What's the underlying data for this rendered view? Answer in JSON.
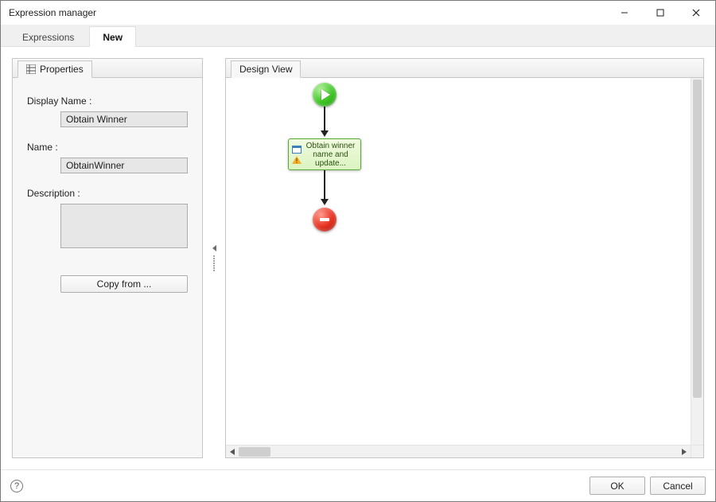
{
  "window": {
    "title": "Expression manager"
  },
  "tabs": {
    "expressions": "Expressions",
    "new": "New"
  },
  "properties": {
    "tab_label": "Properties",
    "display_name_label": "Display Name :",
    "display_name_value": "Obtain Winner",
    "name_label": "Name :",
    "name_value": "ObtainWinner",
    "description_label": "Description :",
    "description_value": "",
    "copy_from_label": "Copy from ..."
  },
  "design": {
    "tab_label": "Design View",
    "task_text": "Obtain winner name and update..."
  },
  "footer": {
    "ok": "OK",
    "cancel": "Cancel"
  }
}
